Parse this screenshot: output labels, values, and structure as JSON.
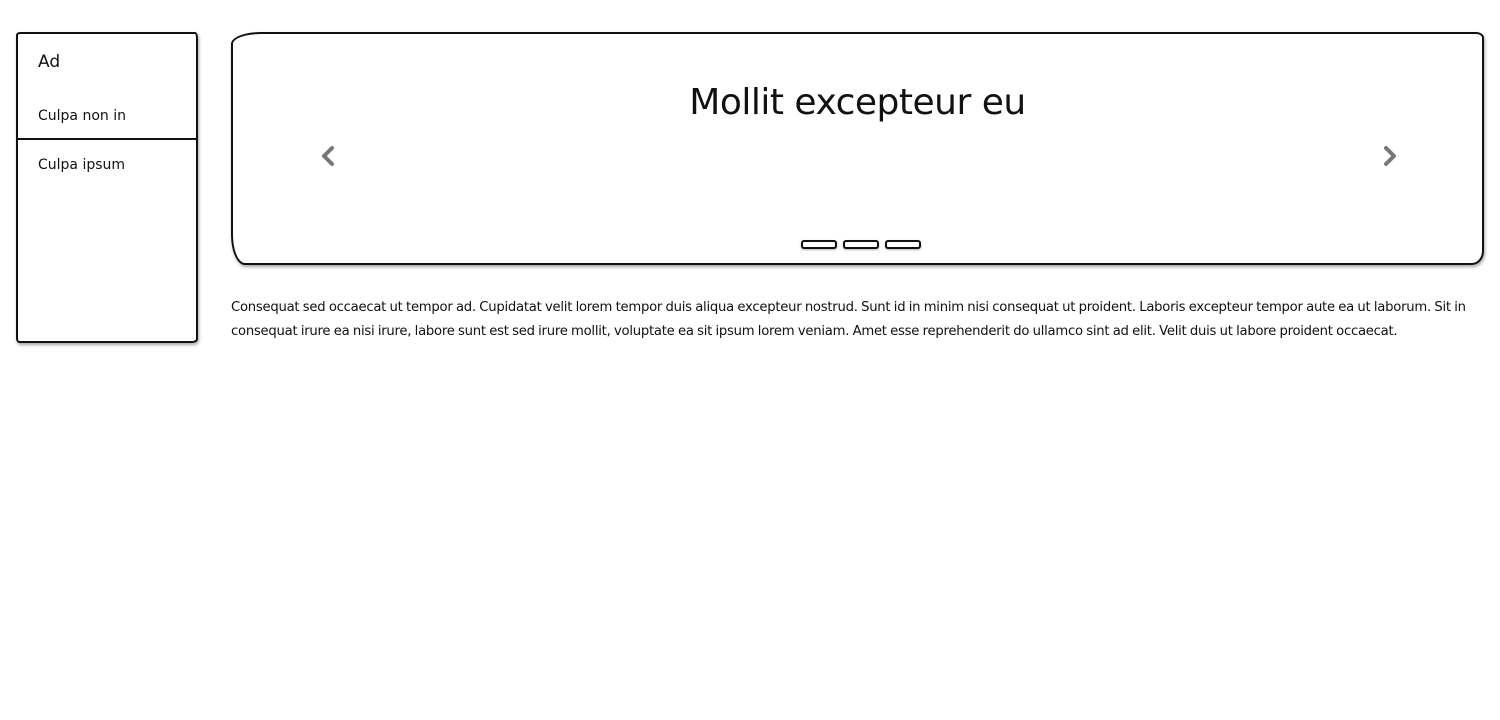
{
  "sidebar": {
    "title": "Ad",
    "links": [
      {
        "label": "Culpa non in"
      },
      {
        "label": "Culpa ipsum"
      }
    ]
  },
  "carousel": {
    "title": "Mollit excepteur eu",
    "prev_icon": "chevron-left-icon",
    "next_icon": "chevron-right-icon",
    "indicator_count": 3
  },
  "content": {
    "paragraph": "Consequat sed occaecat ut tempor ad. Cupidatat velit lorem tempor duis aliqua excepteur nostrud. Sunt id in minim nisi consequat ut proident. Laboris excepteur tempor aute ea ut laborum. Sit in consequat irure ea nisi irure, labore sunt est sed irure mollit, voluptate ea sit ipsum lorem veniam. Amet esse reprehenderit do ullamco sint ad elit. Velit duis ut labore proident occaecat."
  }
}
